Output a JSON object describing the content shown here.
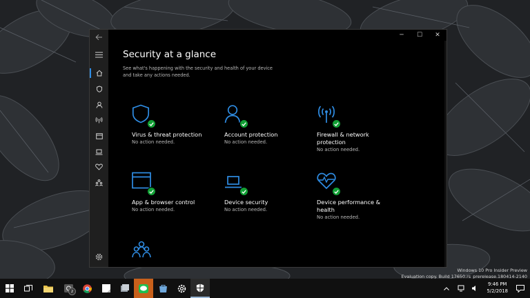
{
  "desktop": {
    "watermark": {
      "line1": "Windows 10 Pro Insider Preview",
      "line2": "Evaluation copy. Build 17650.rs_prerelease.180414-2140"
    }
  },
  "window": {
    "controls": {
      "minimize": "─",
      "maximize": "☐",
      "close": "✕"
    },
    "sidebar": {
      "items": [
        {
          "icon": "back-arrow-icon"
        },
        {
          "icon": "hamburger-menu-icon"
        },
        {
          "icon": "home-icon",
          "active": true
        },
        {
          "icon": "shield-icon"
        },
        {
          "icon": "person-icon"
        },
        {
          "icon": "wireless-signal-icon"
        },
        {
          "icon": "browser-window-icon"
        },
        {
          "icon": "laptop-icon"
        },
        {
          "icon": "heart-icon"
        },
        {
          "icon": "family-icon"
        },
        {
          "icon": "gear-icon"
        }
      ]
    },
    "page": {
      "title": "Security at a glance",
      "subtitle": "See what's happening with the security and health of your device and take any actions needed."
    },
    "tiles": [
      {
        "title": "Virus & threat protection",
        "status": "No action needed.",
        "icon": "shield-icon"
      },
      {
        "title": "Account protection",
        "status": "No action needed.",
        "icon": "person-icon"
      },
      {
        "title": "Firewall & network protection",
        "status": "No action needed.",
        "icon": "wireless-signal-icon"
      },
      {
        "title": "App & browser control",
        "status": "No action needed.",
        "icon": "browser-window-icon"
      },
      {
        "title": "Device security",
        "status": "No action needed.",
        "icon": "laptop-icon"
      },
      {
        "title": "Device performance & health",
        "status": "No action needed.",
        "icon": "heart-pulse-icon"
      },
      {
        "title": "",
        "status": "",
        "icon": "family-icon"
      }
    ],
    "accent_color": "#2f8de4",
    "ok_color": "#12a035"
  },
  "taskbar": {
    "items": [
      {
        "icon": "windows-start-icon"
      },
      {
        "icon": "task-view-icon"
      },
      {
        "icon": "file-explorer-icon"
      },
      {
        "icon": "mail-icon",
        "badge": "2"
      },
      {
        "icon": "chrome-icon"
      },
      {
        "icon": "sticky-notes-icon"
      },
      {
        "icon": "files-icon"
      },
      {
        "icon": "line-messenger-icon"
      },
      {
        "icon": "store-icon"
      },
      {
        "icon": "settings-gear-icon"
      },
      {
        "icon": "windows-security-icon",
        "active": true
      }
    ],
    "clock": {
      "time": "9:46 PM",
      "date": "5/2/2018"
    },
    "notification_icon": "action-center-icon"
  }
}
